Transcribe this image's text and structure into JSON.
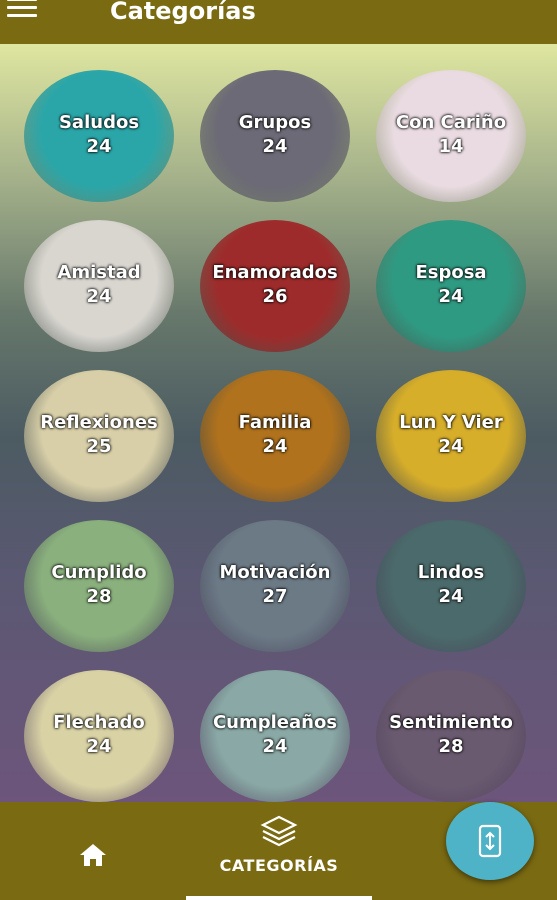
{
  "app": {
    "title": "Categorías"
  },
  "categories": [
    {
      "name": "Saludos",
      "count": "24",
      "bg": "#2ba6a8"
    },
    {
      "name": "Grupos",
      "count": "24",
      "bg": "#6b6a76"
    },
    {
      "name": "Con Cariño",
      "count": "14",
      "bg": "#e9dbe1"
    },
    {
      "name": "Amistad",
      "count": "24",
      "bg": "#d9d6d0"
    },
    {
      "name": "Enamorados",
      "count": "26",
      "bg": "#9e2b2b"
    },
    {
      "name": "Esposa",
      "count": "24",
      "bg": "#2f9a82"
    },
    {
      "name": "Reflexiones",
      "count": "25",
      "bg": "#d8cfa8"
    },
    {
      "name": "Familia",
      "count": "24",
      "bg": "#b0721d"
    },
    {
      "name": "Lun Y Vier",
      "count": "24",
      "bg": "#d7ae2a"
    },
    {
      "name": "Cumplido",
      "count": "28",
      "bg": "#8ab07d"
    },
    {
      "name": "Motivación",
      "count": "27",
      "bg": "#6c7a86"
    },
    {
      "name": "Lindos",
      "count": "24",
      "bg": "#4b6a6b"
    },
    {
      "name": "Flechado",
      "count": "24",
      "bg": "#d9d2a5"
    },
    {
      "name": "Cumpleaños",
      "count": "24",
      "bg": "#8aa9a6"
    },
    {
      "name": "Sentimiento",
      "count": "28",
      "bg": "#6a5a70"
    }
  ],
  "bottom_nav": {
    "categories_label": "CATEGORÍAS"
  },
  "colors": {
    "bar": "#7a6a12",
    "fab": "#4fb3c8"
  },
  "icons": {
    "menu": "menu-icon",
    "home": "home-icon",
    "layers": "layers-icon",
    "fab": "phone-swap-icon"
  }
}
